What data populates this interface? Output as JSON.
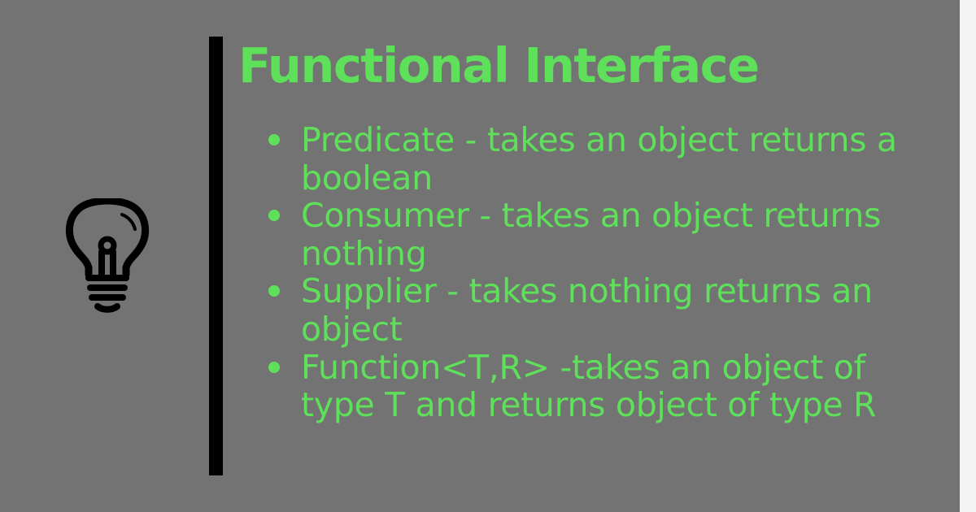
{
  "title": "Functional Interface",
  "icon": "lightbulb-icon",
  "colors": {
    "background": "#737373",
    "accent": "#5fe05b",
    "divider": "#000000"
  },
  "items": [
    {
      "text": "Predicate - takes an object returns a boolean"
    },
    {
      "text": "Consumer - takes an object returns nothing"
    },
    {
      "text": "Supplier - takes nothing returns an object"
    },
    {
      "text": "Function<T,R> -takes an object of type T and returns object of type R"
    }
  ]
}
